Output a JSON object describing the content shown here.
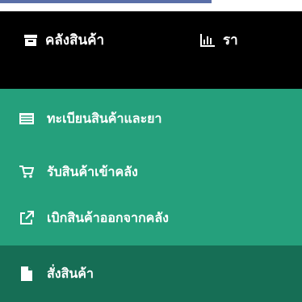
{
  "navbar": {
    "items": [
      {
        "label": "คลังสินค้า",
        "icon": "archive-icon"
      },
      {
        "label": "รา",
        "icon": "bar-chart-icon"
      }
    ]
  },
  "menu": {
    "items": [
      {
        "label": "ทะเบียนสินค้าและยา",
        "icon": "list-icon"
      },
      {
        "label": "รับสินค้าเข้าคลัง",
        "icon": "cart-icon"
      },
      {
        "label": "เบิกสินค้าออกจากคลัง",
        "icon": "external-link-icon"
      },
      {
        "label": "สั่งสินค้า",
        "icon": "file-icon",
        "active": true
      }
    ]
  },
  "colors": {
    "navbar_bg": "#000000",
    "menu_bg": "#25a07c",
    "menu_active_bg": "#166e55",
    "accent": "#5a6fa8"
  }
}
